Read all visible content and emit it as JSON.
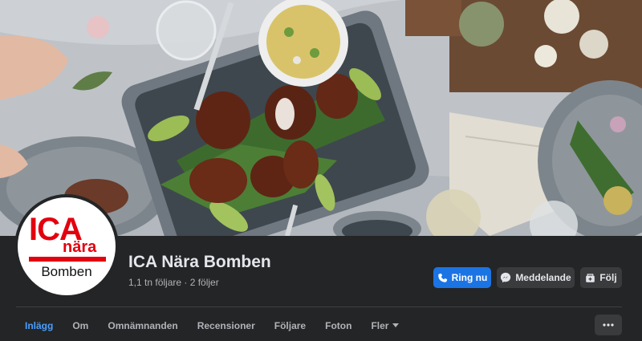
{
  "page": {
    "name": "ICA Nära Bomben",
    "stats": "1,1 tn följare · 2 följer"
  },
  "avatar": {
    "logo_brand": "ICA",
    "logo_sub": "nära",
    "logo_store": "Bomben"
  },
  "actions": {
    "call_label": "Ring nu",
    "message_label": "Meddelande",
    "follow_label": "Följ"
  },
  "tabs": [
    {
      "label": "Inlägg",
      "active": true
    },
    {
      "label": "Om"
    },
    {
      "label": "Omnämnanden"
    },
    {
      "label": "Recensioner"
    },
    {
      "label": "Följare"
    },
    {
      "label": "Foton"
    },
    {
      "label": "Fler"
    }
  ],
  "icons": {
    "call": "phone-icon",
    "message": "messenger-icon",
    "follow": "follow-icon",
    "more_tab": "caret-down-icon",
    "more_button": "ellipsis-icon"
  },
  "colors": {
    "primary": "#1b74e4",
    "active_tab": "#4b9fff",
    "background": "#242526",
    "brand_red": "#e3000f"
  }
}
